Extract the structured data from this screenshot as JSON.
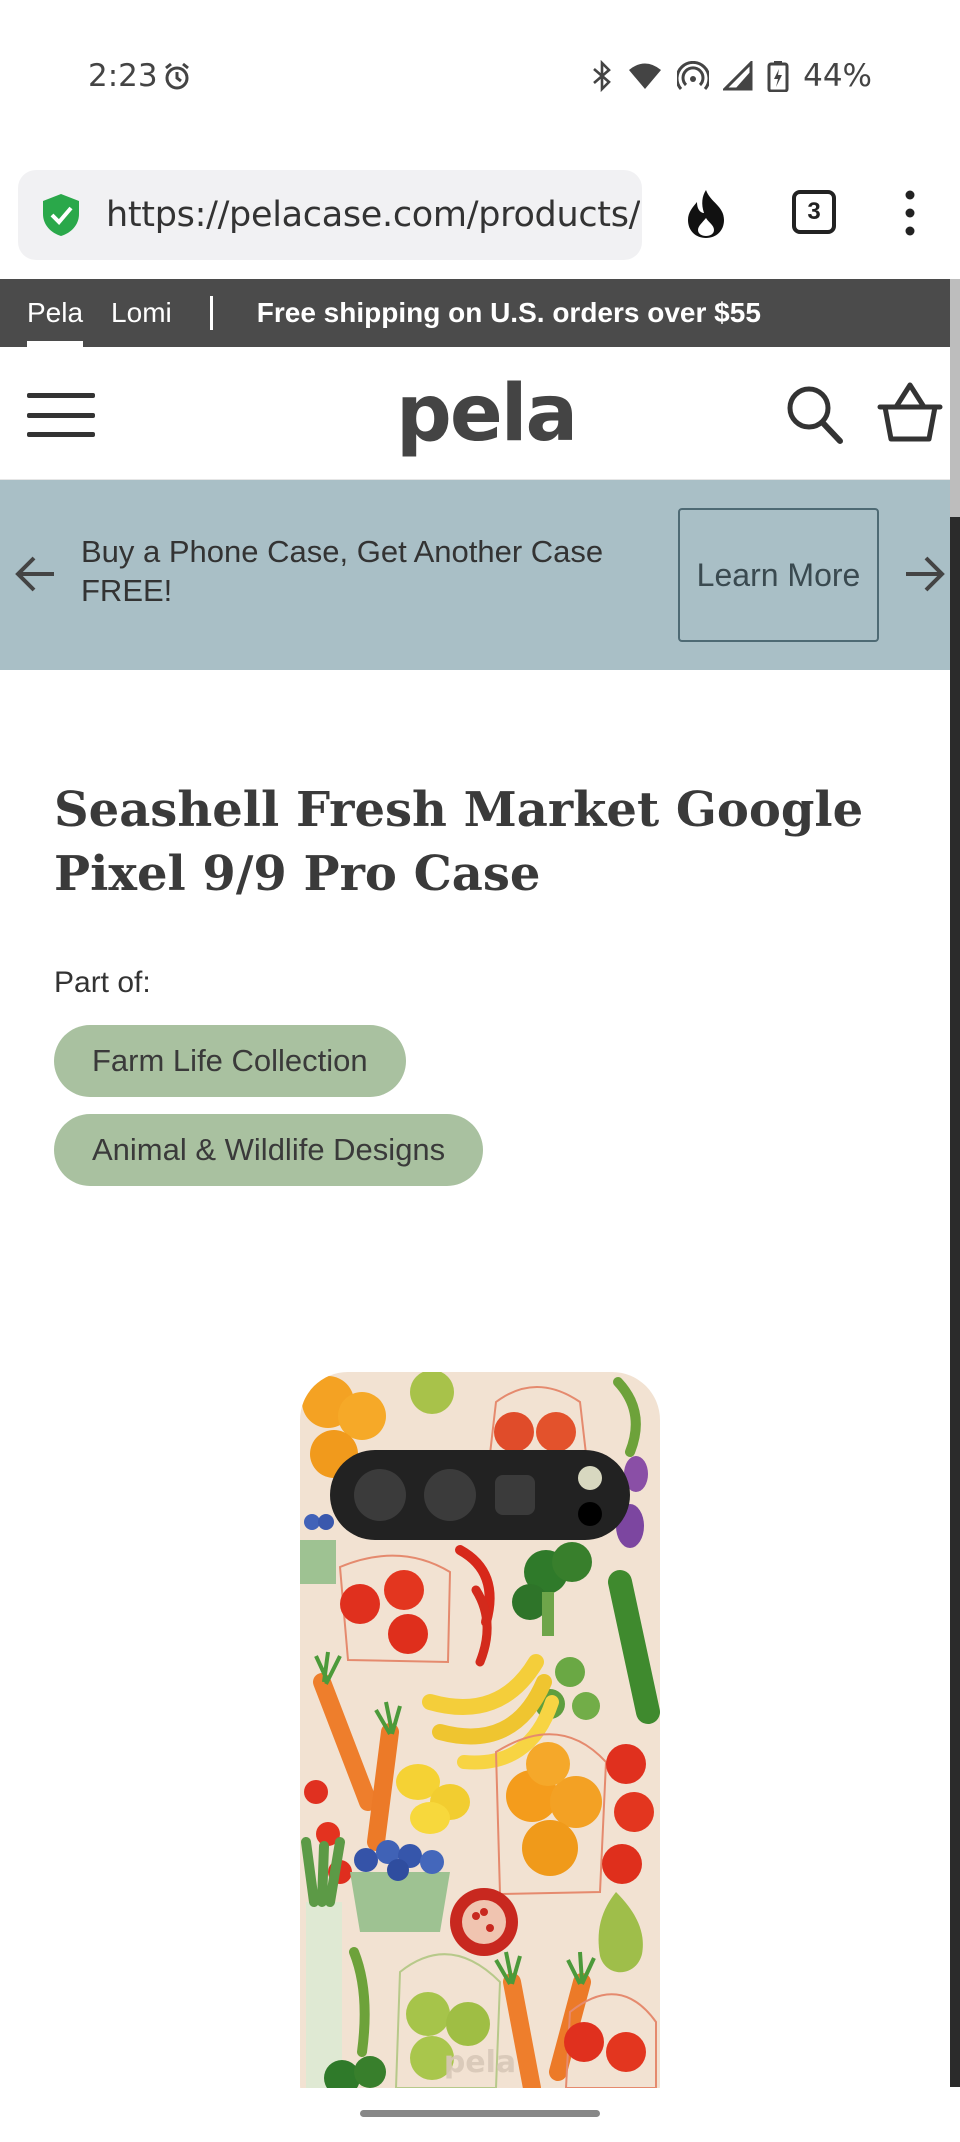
{
  "status_bar": {
    "time": "2:23",
    "battery": "44%",
    "icons": [
      "alarm-icon",
      "bluetooth-icon",
      "wifi-icon",
      "hotspot-icon",
      "signal-icon",
      "battery-icon"
    ]
  },
  "browser": {
    "url": "https://pelacase.com/products/",
    "tab_count": "3",
    "icons": [
      "shield-check-icon",
      "fire-icon",
      "more-vert-icon"
    ]
  },
  "top_strip": {
    "brand_1": "Pela",
    "brand_2": "Lomi",
    "shipping": "Free shipping on U.S. orders over $55"
  },
  "header": {
    "logo": "pela",
    "icons": [
      "menu-icon",
      "search-icon",
      "basket-icon"
    ]
  },
  "promo": {
    "text": "Buy a Phone Case, Get Another Case FREE!",
    "button": "Learn More",
    "icons": [
      "arrow-left-icon",
      "arrow-right-icon"
    ]
  },
  "product": {
    "title": "Seashell Fresh Market Google Pixel 9/9 Pro Case",
    "part_of_label": "Part of:",
    "collections": [
      "Farm Life Collection",
      "Animal & Wildlife Designs"
    ],
    "case_brand": "pela"
  },
  "colors": {
    "strip": "#4b4b4b",
    "promo_bg": "#a9bfc6",
    "pill_bg": "#a9c1a0",
    "case_bg": "#f2e2d2"
  }
}
